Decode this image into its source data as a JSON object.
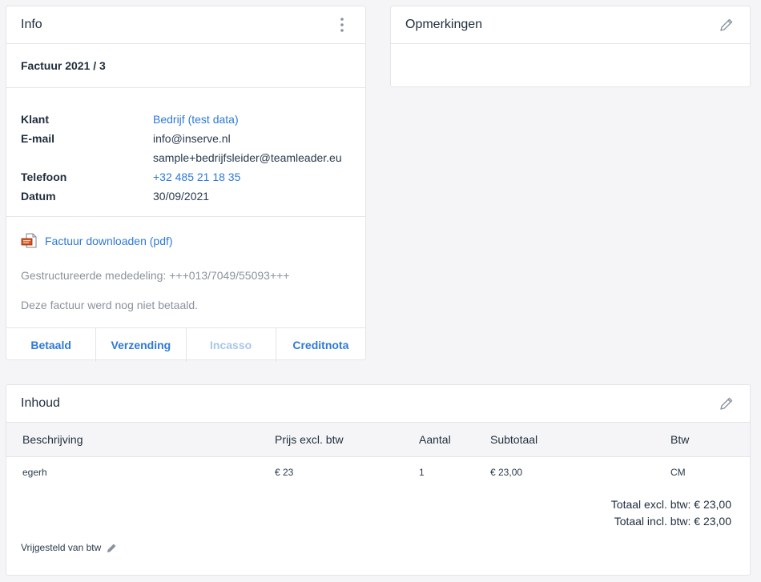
{
  "info": {
    "title": "Info",
    "invoice_number": "Factuur 2021 / 3",
    "details": {
      "client_label": "Klant",
      "client_value": "Bedrijf (test data)",
      "email_label": "E-mail",
      "email_value_1": "info@inserve.nl",
      "email_value_2": "sample+bedrijfsleider@teamleader.eu",
      "phone_label": "Telefoon",
      "phone_value": "+32 485 21 18 35",
      "date_label": "Datum",
      "date_value": "30/09/2021"
    },
    "download_label": "Factuur downloaden (pdf)",
    "structured_communication": "Gestructureerde mededeling: +++013/7049/55093+++",
    "payment_status": "Deze factuur werd nog niet betaald.",
    "actions": {
      "paid": "Betaald",
      "shipping": "Verzending",
      "collection": "Incasso",
      "credit_note": "Creditnota"
    }
  },
  "remarks": {
    "title": "Opmerkingen"
  },
  "content": {
    "title": "Inhoud",
    "columns": {
      "description": "Beschrijving",
      "price": "Prijs excl. btw",
      "quantity": "Aantal",
      "subtotal": "Subtotaal",
      "vat": "Btw"
    },
    "rows": [
      {
        "description": "egerh",
        "price": "€ 23",
        "quantity": "1",
        "subtotal": "€ 23,00",
        "vat": "CM"
      }
    ],
    "total_excl": "Totaal excl. btw: € 23,00",
    "total_incl": "Totaal incl. btw: € 23,00",
    "vat_exempt": "Vrijgesteld van btw"
  },
  "colors": {
    "accent": "#2e7ad6",
    "accent_disabled": "#a9c6ea",
    "background": "#f5f5f7",
    "border": "#e3e5e8"
  },
  "icons": {
    "menu": "vertical-dots-icon",
    "edit": "pencil-icon",
    "pdf": "pdf-file-icon"
  }
}
